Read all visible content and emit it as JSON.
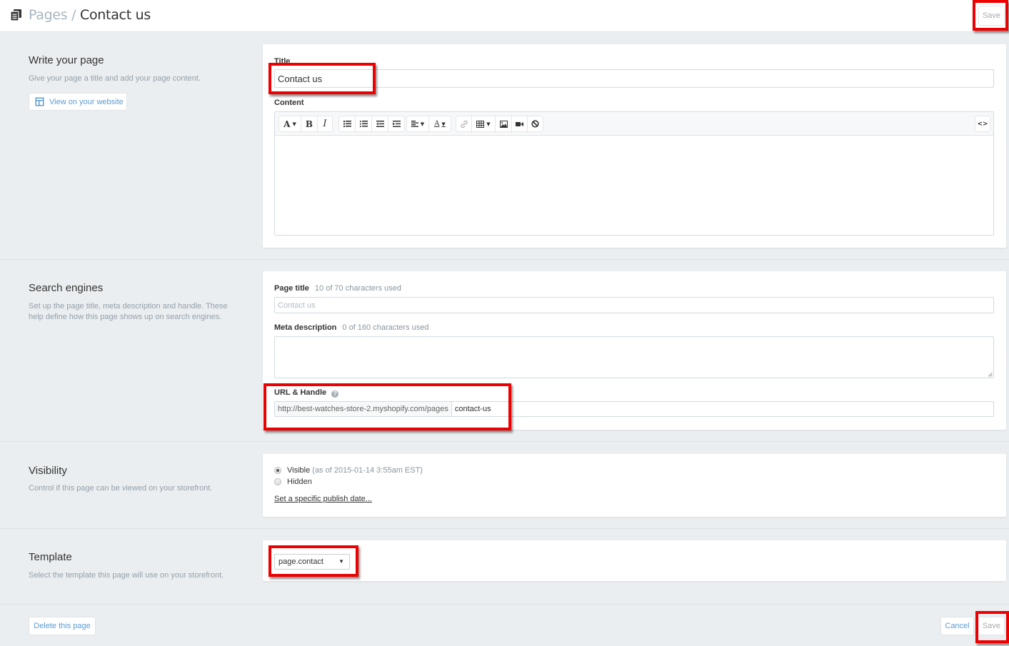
{
  "header": {
    "icon": "pages-icon",
    "breadcrumb_parent": "Pages",
    "breadcrumb_separator": "/",
    "breadcrumb_current": "Contact us",
    "save_label": "Save"
  },
  "write_section": {
    "title": "Write your page",
    "description": "Give your page a title and add your page content.",
    "view_button_label": "View on your website",
    "title_label": "Title",
    "title_value": "Contact us",
    "content_label": "Content",
    "toolbar": {
      "font_button": "A",
      "bold_button": "B",
      "italic_button": "I",
      "text_color_button": "A",
      "html_toggle": "<>"
    },
    "content_value": ""
  },
  "seo_section": {
    "title": "Search engines",
    "description": "Set up the page title, meta description and handle. These help define how this page shows up on search engines.",
    "page_title_label": "Page title",
    "page_title_hint": "10 of 70 characters used",
    "page_title_placeholder": "Contact us",
    "meta_label": "Meta description",
    "meta_hint": "0 of 160 characters used",
    "meta_value": "",
    "url_label": "URL & Handle",
    "url_prefix": "http://best-watches-store-2.myshopify.com/pages",
    "handle_value": "contact-us"
  },
  "visibility_section": {
    "title": "Visibility",
    "description": "Control if this page can be viewed on your storefront.",
    "options": [
      {
        "label": "Visible",
        "note": "(as of 2015-01-14 3:55am EST)",
        "checked": true
      },
      {
        "label": "Hidden",
        "note": "",
        "checked": false
      }
    ],
    "publish_link": "Set a specific publish date..."
  },
  "template_section": {
    "title": "Template",
    "description": "Select the template this page will use on your storefront.",
    "selected_template": "page.contact"
  },
  "footer": {
    "delete_label": "Delete this page",
    "cancel_label": "Cancel",
    "save_label": "Save"
  },
  "colors": {
    "accent_link": "#5b9bd1",
    "highlight_red": "#e00000",
    "page_bg": "#ebeef0"
  }
}
